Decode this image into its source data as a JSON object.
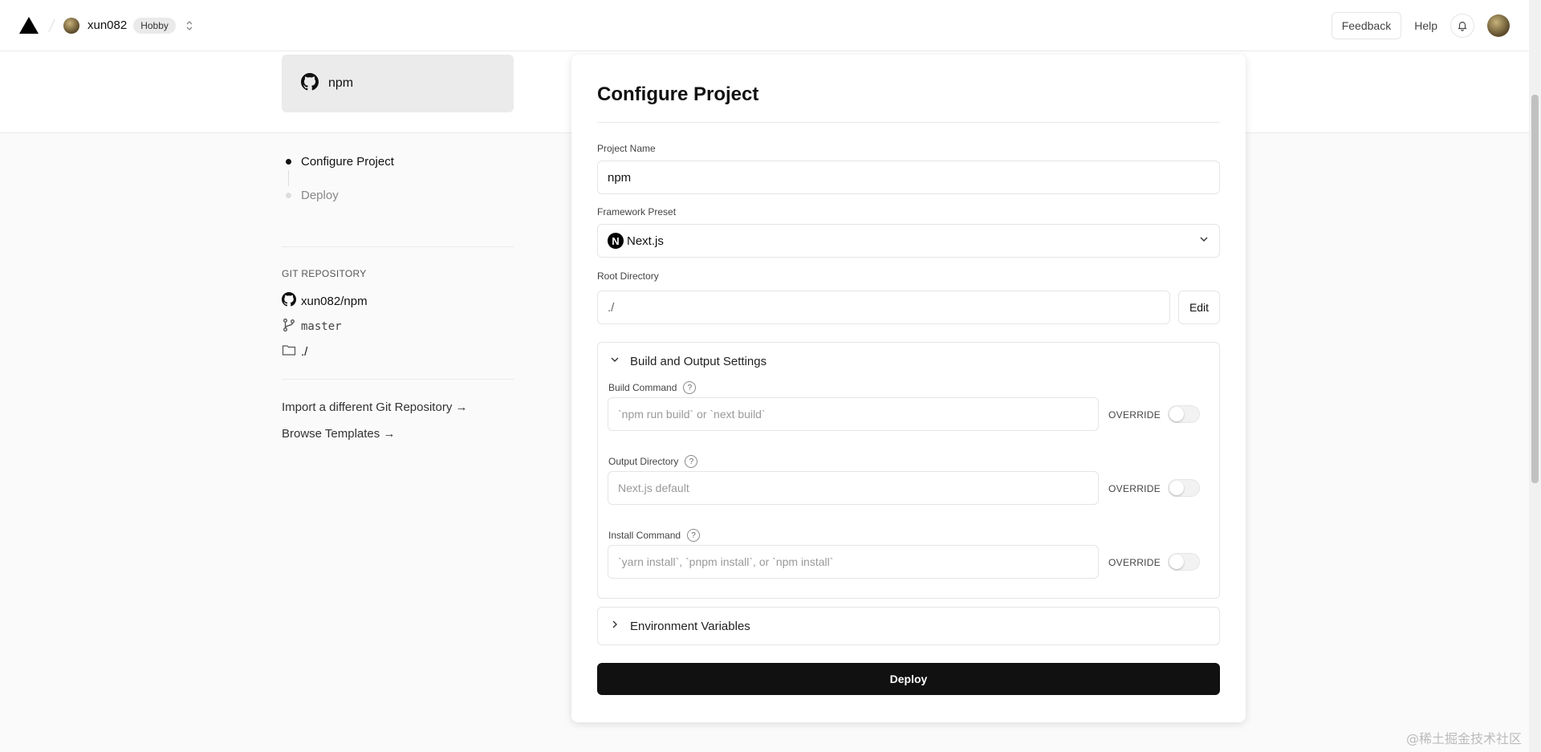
{
  "nav": {
    "user_name": "xun082",
    "plan_badge": "Hobby",
    "feedback_label": "Feedback",
    "help_label": "Help"
  },
  "repo_card": {
    "name": "npm"
  },
  "steps": [
    {
      "label": "Configure Project",
      "active": true
    },
    {
      "label": "Deploy",
      "active": false
    }
  ],
  "git": {
    "section_label": "GIT REPOSITORY",
    "repo": "xun082/npm",
    "branch": "master",
    "directory": "./"
  },
  "links": {
    "import_repo": "Import a different Git Repository →",
    "browse_templates": "Browse Templates →"
  },
  "configure": {
    "title": "Configure Project",
    "project_name_label": "Project Name",
    "project_name_value": "npm",
    "framework_label": "Framework Preset",
    "framework_value": "Next.js",
    "root_dir_label": "Root Directory",
    "root_dir_value": "./",
    "edit_label": "Edit",
    "build_settings": {
      "title": "Build and Output Settings",
      "build_command_label": "Build Command",
      "build_command_placeholder": "`npm run build` or `next build`",
      "output_dir_label": "Output Directory",
      "output_dir_placeholder": "Next.js default",
      "install_command_label": "Install Command",
      "install_command_placeholder": "`yarn install`, `pnpm install`, or `npm install`",
      "override_label": "OVERRIDE",
      "build_override": false,
      "output_override": false,
      "install_override": false
    },
    "env_vars_title": "Environment Variables",
    "deploy_label": "Deploy"
  },
  "watermark": "@稀土掘金技术社区",
  "colors": {
    "primary": "#111111",
    "background": "#fafafa",
    "border": "#e5e5e5"
  }
}
